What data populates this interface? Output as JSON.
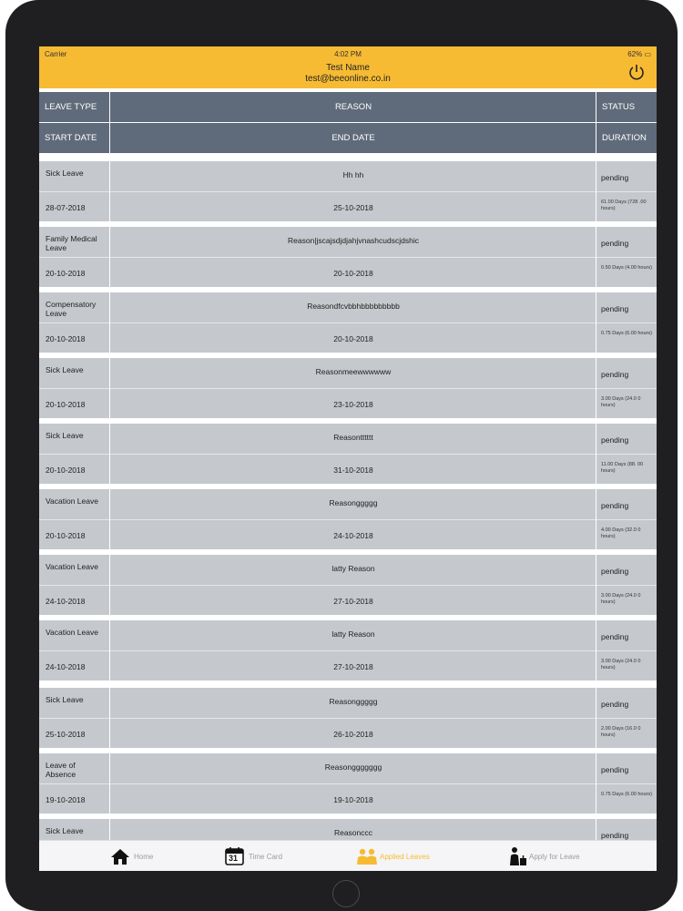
{
  "status_bar": {
    "carrier": "Carrier",
    "time": "4:02 PM",
    "battery": "62%"
  },
  "header": {
    "name": "Test Name",
    "email": "test@beeonline.co.in"
  },
  "columns": {
    "leave_type": "LEAVE TYPE",
    "reason": "REASON",
    "status": "STATUS",
    "start_date": "START DATE",
    "end_date": "END DATE",
    "duration": "DURATION"
  },
  "rows": [
    {
      "type": "Sick Leave",
      "reason": "Hh hh",
      "status": "pending",
      "start": "28-07-2018",
      "end": "25-10-2018",
      "duration": "61.00 Days (728 .00 hours)"
    },
    {
      "type": "Family Medical Leave",
      "reason": "Reason|jscajsdjdjahjvnashcudscjdshic",
      "status": "pending",
      "start": "20-10-2018",
      "end": "20-10-2018",
      "duration": "0.50 Days (4.00 hours)"
    },
    {
      "type": "Compensatory Leave",
      "reason": "Reasondfcvbbhbbbbbbbbb",
      "status": "pending",
      "start": "20-10-2018",
      "end": "20-10-2018",
      "duration": "0.75 Days (6.00 hours)"
    },
    {
      "type": "Sick Leave",
      "reason": "Reasonmeewwwwww",
      "status": "pending",
      "start": "20-10-2018",
      "end": "23-10-2018",
      "duration": "3.00 Days (24.0 0 hours)"
    },
    {
      "type": "Sick Leave",
      "reason": "Reasontttttt",
      "status": "pending",
      "start": "20-10-2018",
      "end": "31-10-2018",
      "duration": "11.00 Days (88. 00 hours)"
    },
    {
      "type": "Vacation Leave",
      "reason": "Reasonggggg",
      "status": "pending",
      "start": "20-10-2018",
      "end": "24-10-2018",
      "duration": "4.00 Days (32.0 0 hours)"
    },
    {
      "type": "Vacation Leave",
      "reason": "latty Reason",
      "status": "pending",
      "start": "24-10-2018",
      "end": "27-10-2018",
      "duration": "3.00 Days (24.0 0 hours)"
    },
    {
      "type": "Vacation Leave",
      "reason": "latty Reason",
      "status": "pending",
      "start": "24-10-2018",
      "end": "27-10-2018",
      "duration": "3.00 Days (24.0 0 hours)"
    },
    {
      "type": "Sick Leave",
      "reason": "Reasonggggg",
      "status": "pending",
      "start": "25-10-2018",
      "end": "26-10-2018",
      "duration": "2.00 Days (16.0 0 hours)"
    },
    {
      "type": "Leave of Absence",
      "reason": "Reasonggggggg",
      "status": "pending",
      "start": "19-10-2018",
      "end": "19-10-2018",
      "duration": "0.75 Days (6.00 hours)"
    },
    {
      "type": "Sick Leave",
      "reason": "Reasonccc",
      "status": "pending",
      "start": "",
      "end": "",
      "duration": ""
    }
  ],
  "tabs": [
    {
      "label": "Home",
      "icon": "home-icon",
      "active": false
    },
    {
      "label": "Time Card",
      "icon": "calendar-icon",
      "active": false,
      "badge": "31"
    },
    {
      "label": "Applied Leaves",
      "icon": "people-icon",
      "active": true
    },
    {
      "label": "Apply for Leave",
      "icon": "apply-leave-icon",
      "active": false
    }
  ],
  "colors": {
    "accent": "#f6bb33",
    "header_row": "#5f6b7a",
    "row_bg": "#c5c9cd",
    "device": "#1f1f22"
  }
}
